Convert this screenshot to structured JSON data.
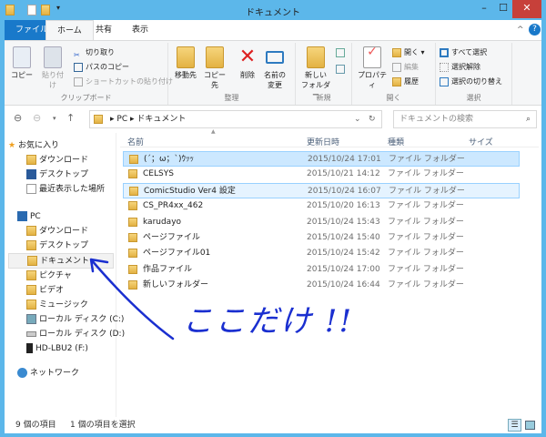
{
  "window": {
    "title": "ドキュメント",
    "minimize": "–",
    "maximize": "☐",
    "close": "✕"
  },
  "tabs": [
    {
      "label": "ファイル",
      "active": false,
      "file": true
    },
    {
      "label": "ホーム",
      "active": true
    },
    {
      "label": "共有"
    },
    {
      "label": "表示"
    }
  ],
  "ribbon": {
    "clipboard": {
      "label": "クリップボード",
      "copy": "コピー",
      "paste": "貼り付け",
      "cut": "切り取り",
      "copy_path": "パスのコピー",
      "paste_shortcut": "ショートカットの貼り付け"
    },
    "organize": {
      "label": "整理",
      "move_to": "移動先",
      "copy_to": "コピー先",
      "delete": "削除",
      "rename_1": "名前の",
      "rename_2": "変更"
    },
    "new": {
      "label": "新規",
      "new_folder_1": "新しい",
      "new_folder_2": "フォルダー"
    },
    "open": {
      "label": "開く",
      "properties": "プロパティ",
      "open": "開く",
      "edit": "編集",
      "history": "履歴"
    },
    "select": {
      "label": "選択",
      "select_all": "すべて選択",
      "select_none": "選択解除",
      "invert": "選択の切り替え"
    }
  },
  "address": {
    "path": [
      "PC",
      "ドキュメント"
    ],
    "search_placeholder": "ドキュメントの検索"
  },
  "sidebar": {
    "favorites": {
      "label": "お気に入り",
      "items": [
        "ダウンロード",
        "デスクトップ",
        "最近表示した場所"
      ]
    },
    "pc": {
      "label": "PC",
      "items": [
        "ダウンロード",
        "デスクトップ",
        "ドキュメント",
        "ピクチャ",
        "ビデオ",
        "ミュージック",
        "ローカル ディスク (C:)",
        "ローカル ディスク (D:)",
        "HD-LBU2 (F:)"
      ]
    },
    "network": {
      "label": "ネットワーク"
    }
  },
  "columns": {
    "name": "名前",
    "date": "更新日時",
    "type": "種類",
    "size": "サイズ"
  },
  "files": [
    {
      "name": "(´；ω；`)ｳｯｯ",
      "date": "2015/10/24 17:01",
      "type": "ファイル フォルダー",
      "state": "selected"
    },
    {
      "name": "CELSYS",
      "date": "2015/10/21 14:12",
      "type": "ファイル フォルダー"
    },
    {
      "name": "ComicStudio Ver4 設定",
      "date": "2015/10/24 16:07",
      "type": "ファイル フォルダー",
      "state": "hover"
    },
    {
      "name": "CS_PR4xx_462",
      "date": "2015/10/20 16:13",
      "type": "ファイル フォルダー"
    },
    {
      "name": "karudayo",
      "date": "2015/10/24 15:43",
      "type": "ファイル フォルダー"
    },
    {
      "name": "ページファイル",
      "date": "2015/10/24 15:40",
      "type": "ファイル フォルダー"
    },
    {
      "name": "ページファイル01",
      "date": "2015/10/24 15:42",
      "type": "ファイル フォルダー"
    },
    {
      "name": "作品ファイル",
      "date": "2015/10/24 17:00",
      "type": "ファイル フォルダー"
    },
    {
      "name": "新しいフォルダー",
      "date": "2015/10/24 16:44",
      "type": "ファイル フォルダー"
    }
  ],
  "status": {
    "count": "9 個の項目",
    "selected": "1 個の項目を選択"
  },
  "annotation": {
    "text": "ここだけ !!",
    "color": "#1a2fd0"
  }
}
